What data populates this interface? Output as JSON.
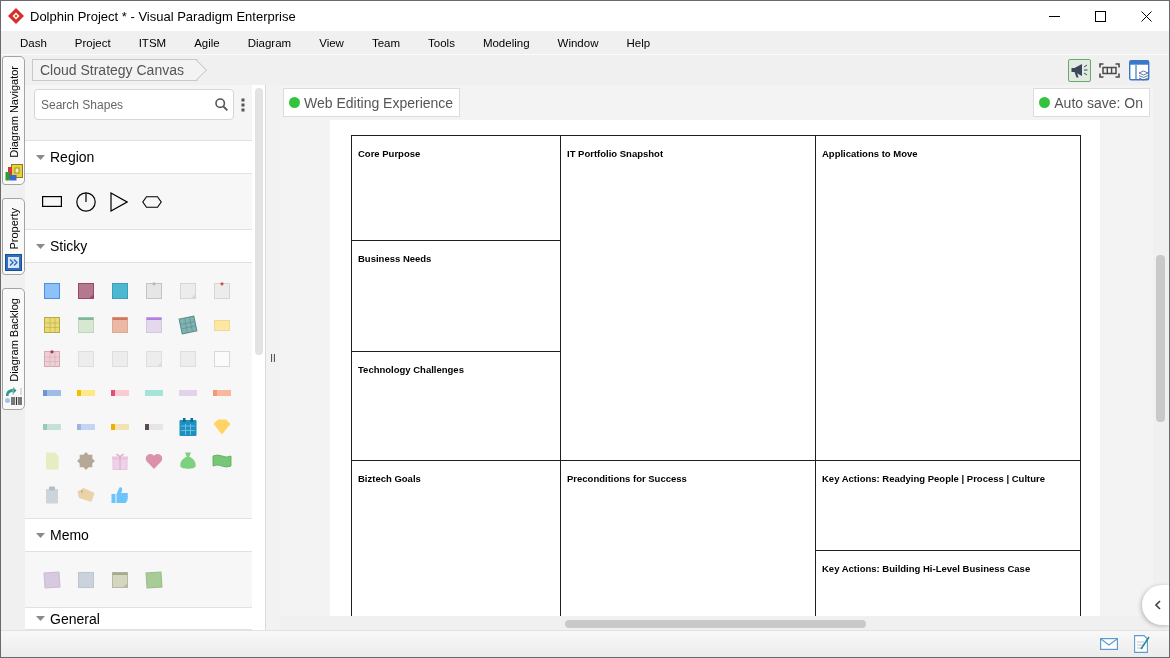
{
  "window": {
    "title": "Dolphin Project * - Visual Paradigm Enterprise"
  },
  "menu": [
    {
      "label": "Dash"
    },
    {
      "label": "Project"
    },
    {
      "label": "ITSM"
    },
    {
      "label": "Agile"
    },
    {
      "label": "Diagram"
    },
    {
      "label": "View"
    },
    {
      "label": "Team"
    },
    {
      "label": "Tools"
    },
    {
      "label": "Modeling"
    },
    {
      "label": "Window"
    },
    {
      "label": "Help"
    }
  ],
  "side_tabs": [
    {
      "label": "Diagram Navigator"
    },
    {
      "label": "Property"
    },
    {
      "label": "Diagram Backlog"
    }
  ],
  "breadcrumb": {
    "label": "Cloud Strategy Canvas"
  },
  "toolbar": [
    {
      "selected": true
    },
    {
      "selected": false
    },
    {
      "selected": false
    }
  ],
  "shapes_panel": {
    "search": {
      "placeholder": "Search Shapes"
    },
    "sections": [
      {
        "title": "Region",
        "kind": "region",
        "expanded": true
      },
      {
        "title": "Sticky",
        "kind": "sticky",
        "expanded": true
      },
      {
        "title": "Memo",
        "kind": "memo",
        "expanded": true
      },
      {
        "title": "General",
        "kind": "general",
        "expanded": true
      }
    ]
  },
  "canvas": {
    "badges": [
      {
        "label": "Web Editing Experience",
        "on": true
      },
      {
        "label": "Auto save: On",
        "on": true
      }
    ],
    "blocks": [
      {
        "title": "Core Purpose"
      },
      {
        "title": "IT Portfolio Snapshot"
      },
      {
        "title": "Applications to Move"
      },
      {
        "title": "Business Needs"
      },
      {
        "title": "Technology Challenges"
      },
      {
        "title": "Biztech Goals"
      },
      {
        "title": "Preconditions for Success"
      },
      {
        "title": "Key Actions: Readying People | Process | Culture"
      },
      {
        "title": "Key Actions: Building Hi-Level Business Case"
      }
    ]
  }
}
